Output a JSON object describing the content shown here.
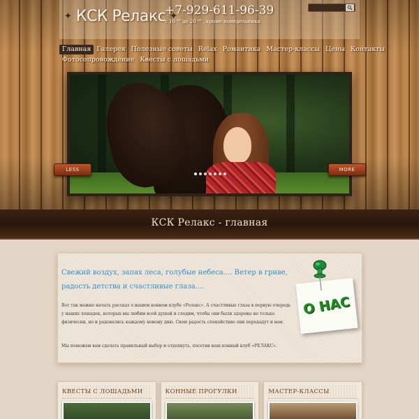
{
  "header": {
    "logo_text": "КСК Релакс",
    "phone": "+7-929-611-96-39",
    "hours": "с 10 ⁰⁰ до 20 ⁰⁰ , кроме понедельника",
    "search_placeholder": ""
  },
  "nav": {
    "row1": [
      "Главная",
      "Галерея",
      "Полезные советы",
      "Relax",
      "Романтика",
      "Мастер-классы",
      "Цены",
      "Контакты"
    ],
    "row2": [
      "Фотосопровождение",
      "Квесты с лошадьми"
    ],
    "active_index": 0
  },
  "slider": {
    "prev_label": "LESS",
    "next_label": "MORE",
    "slide_count": 7,
    "active_slide": 0
  },
  "page": {
    "title": "КСК Релакс - главная"
  },
  "content": {
    "headline": "Свежий воздух, запах леса, голубые небеса.... Ветер в гриве, радость детства и счастливые глаза....",
    "paragraph1": "Вот так можно начать рассказ о нашем конном клубе «Релакс». А счастливые глаза в первую очередь у наших лошадок, которых мы любим всей душой и следим, чтобы они были здоровы не только физически, но и радовались каждому новому дню. Свою радость спокойствие они передадут и вам.",
    "paragraph2": "Мы поможем вам сделать правильный выбор и отдохнуть, посетив наш конный клуб «РЕЛАКС».",
    "note_label": "О НАС"
  },
  "boxes": [
    {
      "title": "КВЕСТЫ С ЛОШАДЬМИ"
    },
    {
      "title": "КОННЫЕ ПРОГУЛКИ"
    },
    {
      "title": "МАСТЕР-КЛАССЫ"
    }
  ],
  "icons": {
    "search": "search-icon",
    "pin": "pushpin-icon"
  },
  "colors": {
    "headline_blue": "#2d8fcf",
    "note_green": "#1f8a1f",
    "title_band": "#2a170b",
    "button_orange": "#b04a22"
  }
}
